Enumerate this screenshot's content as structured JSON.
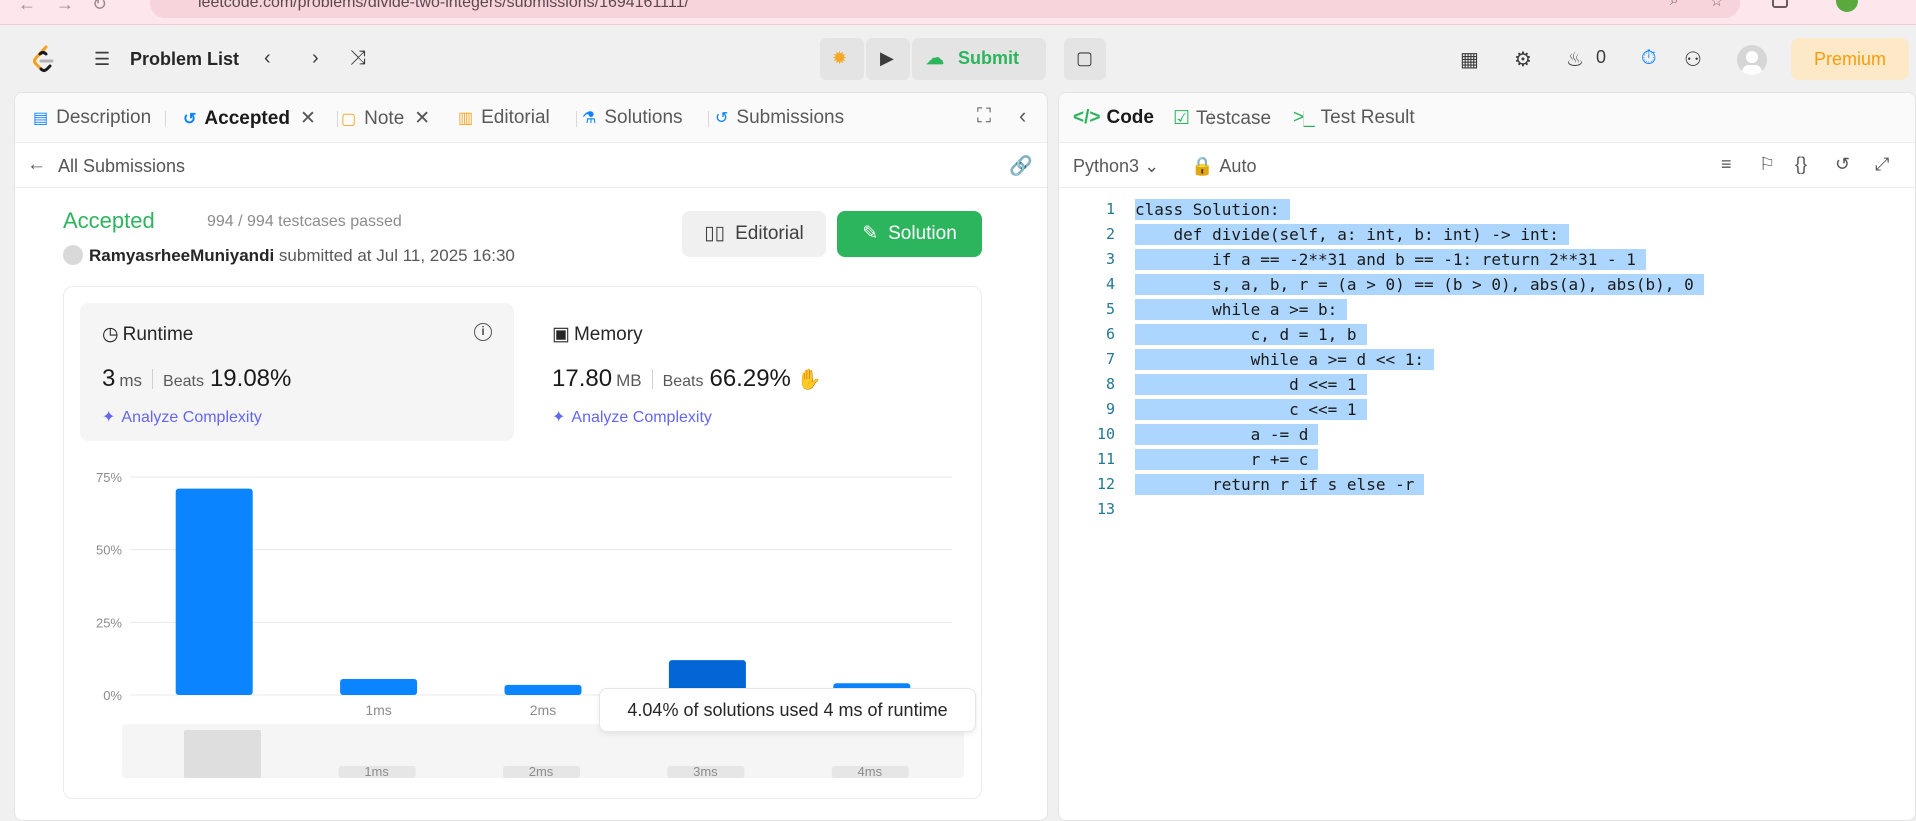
{
  "browser": {
    "url": "leetcode.com/problems/divide-two-integers/submissions/1694161111/"
  },
  "topbar": {
    "problem_list_label": "Problem List",
    "submit_label": "Submit",
    "streak_count": "0",
    "premium_label": "Premium"
  },
  "left_tabs": [
    {
      "label": "Description",
      "icon": "description-icon"
    },
    {
      "label": "Accepted",
      "icon": "history-icon",
      "closable": true,
      "active": true
    },
    {
      "label": "Note",
      "icon": "note-icon",
      "closable": true
    },
    {
      "label": "Editorial",
      "icon": "book-icon"
    },
    {
      "label": "Solutions",
      "icon": "flask-icon"
    },
    {
      "label": "Submissions",
      "icon": "history-icon"
    }
  ],
  "submission": {
    "back_label": "All Submissions",
    "status": "Accepted",
    "testcases": "994 / 994 testcases passed",
    "username": "RamyasrheeMuniyandi",
    "submitted_text": "submitted at Jul 11, 2025 16:30",
    "editorial_btn": "Editorial",
    "solution_btn": "Solution"
  },
  "runtime": {
    "title": "Runtime",
    "value": "3",
    "unit": "ms",
    "beats_label": "Beats",
    "beats_pct": "19.08%",
    "analyze": "Analyze Complexity"
  },
  "memory": {
    "title": "Memory",
    "value": "17.80",
    "unit": "MB",
    "beats_label": "Beats",
    "beats_pct": "66.29%",
    "analyze": "Analyze Complexity"
  },
  "chart_data": {
    "type": "bar",
    "categories": [
      "",
      "1ms",
      "2ms",
      "3ms",
      "4ms"
    ],
    "values": [
      71,
      5.5,
      3.5,
      12,
      4.04
    ],
    "highlight_index": 3,
    "ylim": [
      0,
      75
    ],
    "yticks": [
      "0%",
      "25%",
      "50%",
      "75%"
    ],
    "ytick_values": [
      0,
      25,
      50,
      75
    ],
    "grid": true,
    "tooltip": "4.04% of solutions used 4 ms of runtime",
    "mini_labels": [
      "1ms",
      "2ms",
      "3ms",
      "4ms"
    ],
    "colors": {
      "bar": "#0a84ff",
      "highlight": "#0366d6"
    }
  },
  "right_tabs": [
    {
      "label": "Code",
      "icon": "code-icon",
      "active": true
    },
    {
      "label": "Testcase",
      "icon": "checkbox-icon"
    },
    {
      "label": "Test Result",
      "icon": "terminal-icon"
    }
  ],
  "editor": {
    "language": "Python3",
    "mode": "Auto",
    "lines": [
      "class Solution:",
      "    def divide(self, a: int, b: int) -> int:",
      "        if a == -2**31 and b == -1: return 2**31 - 1",
      "        s, a, b, r = (a > 0) == (b > 0), abs(a), abs(b), 0",
      "        while a >= b:",
      "            c, d = 1, b",
      "            while a >= d << 1:",
      "                d <<= 1",
      "                c <<= 1",
      "            a -= d",
      "            r += c",
      "        return r if s else -r",
      ""
    ]
  },
  "colors": {
    "accent_green": "#2db55d",
    "accent_blue": "#0a84ff",
    "premium_orange": "#f59e0b",
    "selection": "#add6ff"
  }
}
